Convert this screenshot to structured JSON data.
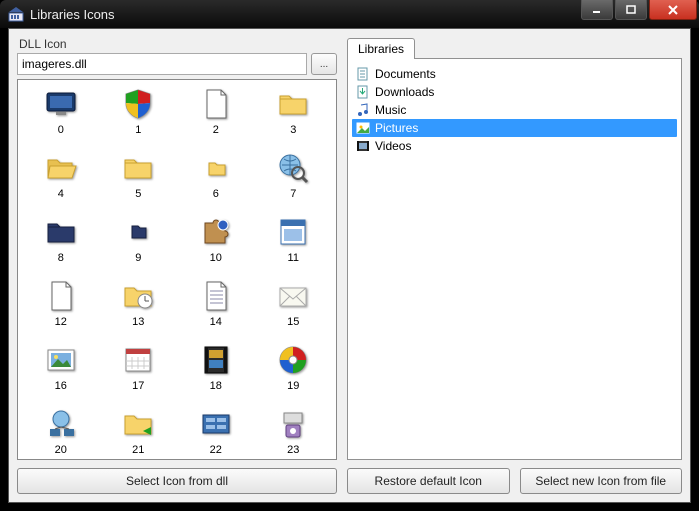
{
  "window": {
    "title": "Libraries Icons"
  },
  "left": {
    "group_label": "DLL Icon",
    "path_value": "imageres.dll",
    "browse_label": "...",
    "button_label": "Select Icon from dll",
    "icons": [
      {
        "idx": "0",
        "kind": "monitor-blue"
      },
      {
        "idx": "1",
        "kind": "shield"
      },
      {
        "idx": "2",
        "kind": "page-blank"
      },
      {
        "idx": "3",
        "kind": "folder"
      },
      {
        "idx": "4",
        "kind": "folder-open"
      },
      {
        "idx": "5",
        "kind": "folder"
      },
      {
        "idx": "6",
        "kind": "folder-small"
      },
      {
        "idx": "7",
        "kind": "globe-mag"
      },
      {
        "idx": "8",
        "kind": "folder-dark"
      },
      {
        "idx": "9",
        "kind": "folder-dark-small"
      },
      {
        "idx": "10",
        "kind": "puzzle"
      },
      {
        "idx": "11",
        "kind": "window-blue"
      },
      {
        "idx": "12",
        "kind": "page-blank"
      },
      {
        "idx": "13",
        "kind": "folder-clock"
      },
      {
        "idx": "14",
        "kind": "page-lines"
      },
      {
        "idx": "15",
        "kind": "envelope"
      },
      {
        "idx": "16",
        "kind": "picture"
      },
      {
        "idx": "17",
        "kind": "calendar"
      },
      {
        "idx": "18",
        "kind": "film"
      },
      {
        "idx": "19",
        "kind": "disc"
      },
      {
        "idx": "20",
        "kind": "network"
      },
      {
        "idx": "21",
        "kind": "folder-share"
      },
      {
        "idx": "22",
        "kind": "panel"
      },
      {
        "idx": "23",
        "kind": "device"
      }
    ]
  },
  "right": {
    "tab_label": "Libraries",
    "restore_label": "Restore default Icon",
    "select_file_label": "Select new Icon from file",
    "items": [
      {
        "label": "Documents",
        "icon": "doc",
        "selected": false
      },
      {
        "label": "Downloads",
        "icon": "download",
        "selected": false
      },
      {
        "label": "Music",
        "icon": "music",
        "selected": false
      },
      {
        "label": "Pictures",
        "icon": "pictures",
        "selected": true
      },
      {
        "label": "Videos",
        "icon": "video",
        "selected": false
      }
    ]
  }
}
